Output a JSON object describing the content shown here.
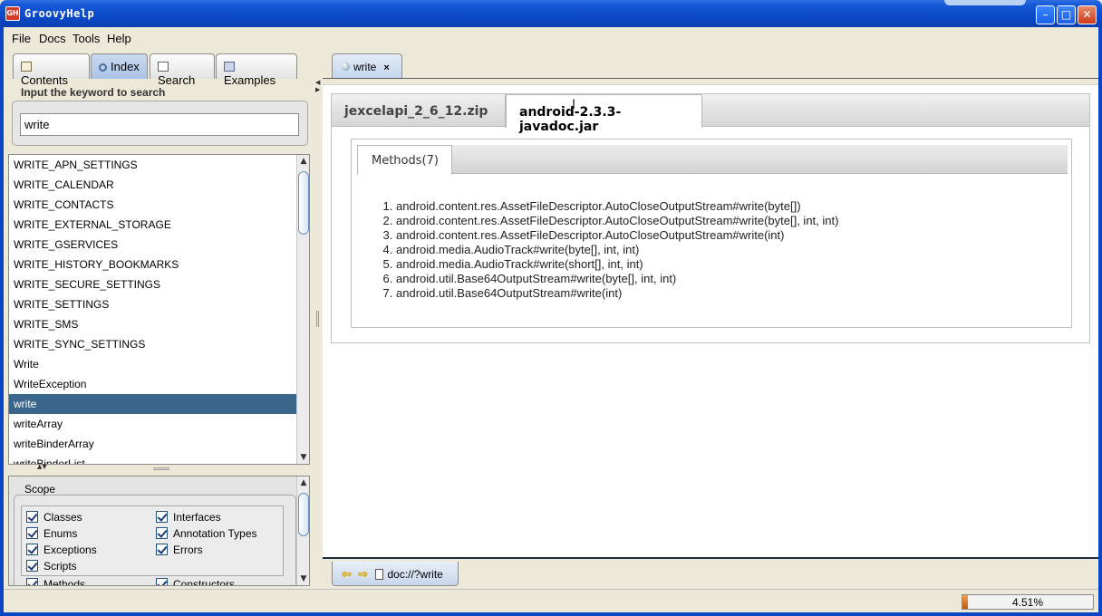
{
  "window": {
    "title": "GroovyHelp",
    "icon_label": "GH"
  },
  "menu": [
    {
      "label": "File"
    },
    {
      "label": "Docs"
    },
    {
      "label": "Tools"
    },
    {
      "label": "Help"
    }
  ],
  "left_tabs": [
    {
      "label": "Contents",
      "icon": "book-icon"
    },
    {
      "label": "Index",
      "icon": "magnifier-icon",
      "active": true
    },
    {
      "label": "Search",
      "icon": "search-doc-icon"
    },
    {
      "label": "Examples",
      "icon": "examples-icon"
    }
  ],
  "search": {
    "label": "Input the keyword to search",
    "value": "write"
  },
  "index_list": [
    "WRITE_APN_SETTINGS",
    "WRITE_CALENDAR",
    "WRITE_CONTACTS",
    "WRITE_EXTERNAL_STORAGE",
    "WRITE_GSERVICES",
    "WRITE_HISTORY_BOOKMARKS",
    "WRITE_SECURE_SETTINGS",
    "WRITE_SETTINGS",
    "WRITE_SMS",
    "WRITE_SYNC_SETTINGS",
    "Write",
    "WriteException",
    "write",
    "writeArray",
    "writeBinderArray",
    "writeBinderList"
  ],
  "selected_index": "write",
  "scope": {
    "label": "Scope",
    "options": [
      {
        "label": "Classes",
        "checked": true
      },
      {
        "label": "Interfaces",
        "checked": true
      },
      {
        "label": "Enums",
        "checked": true
      },
      {
        "label": "Annotation Types",
        "checked": true
      },
      {
        "label": "Exceptions",
        "checked": true
      },
      {
        "label": "Errors",
        "checked": true
      },
      {
        "label": "Scripts",
        "checked": true
      },
      {
        "label": "Methods",
        "checked": true
      },
      {
        "label": "Constructors",
        "checked": true
      }
    ]
  },
  "doc_tab": {
    "label": "write",
    "close": "×"
  },
  "jar_tabs": [
    {
      "label": "jexcelapi_2_6_12.zip"
    },
    {
      "label": "android-2.3.3-javadoc.jar",
      "active": true
    }
  ],
  "methods_tab": {
    "label": "Methods(7)"
  },
  "methods": [
    "android.content.res.AssetFileDescriptor.AutoCloseOutputStream#write(byte[])",
    "android.content.res.AssetFileDescriptor.AutoCloseOutputStream#write(byte[], int, int)",
    "android.content.res.AssetFileDescriptor.AutoCloseOutputStream#write(int)",
    "android.media.AudioTrack#write(byte[], int, int)",
    "android.media.AudioTrack#write(short[], int, int)",
    "android.util.Base64OutputStream#write(byte[], int, int)",
    "android.util.Base64OutputStream#write(int)"
  ],
  "nav": {
    "url": "doc://?write"
  },
  "status": {
    "progress_text": "4.51%",
    "progress_fraction": 0.0451
  },
  "colors": {
    "titlebar": "#0a46c4",
    "selection": "#3a668c",
    "progress": "#e07a20"
  }
}
